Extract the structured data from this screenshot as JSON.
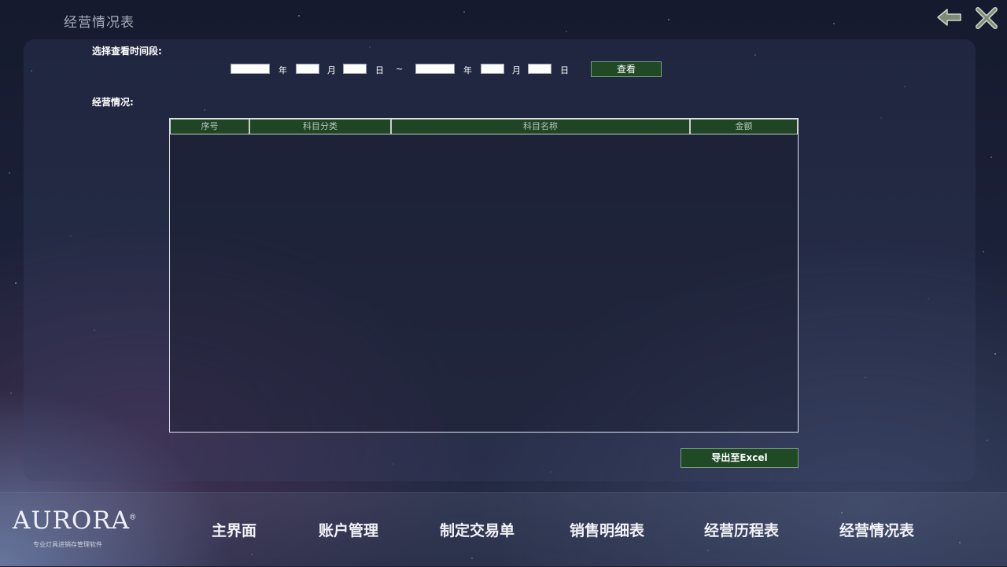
{
  "header": {
    "title": "经营情况表"
  },
  "icons": {
    "back": "back-arrow-icon",
    "close": "close-icon"
  },
  "filter": {
    "label": "选择查看时间段:",
    "unit_year": "年",
    "unit_month": "月",
    "unit_day": "日",
    "separator": "~",
    "start": {
      "year": "",
      "month": "",
      "day": ""
    },
    "end": {
      "year": "",
      "month": "",
      "day": ""
    },
    "view_button": "查看"
  },
  "section": {
    "label": "经营情况:"
  },
  "table": {
    "columns": [
      "序号",
      "科目分类",
      "科目名称",
      "金额"
    ],
    "rows": []
  },
  "export_button": "导出至Excel",
  "logo": {
    "name": "AURORA",
    "mark": "®",
    "tagline": "专业灯具进销存管理软件"
  },
  "nav": {
    "items": [
      "主界面",
      "账户管理",
      "制定交易单",
      "销售明细表",
      "经营历程表",
      "经营情况表"
    ]
  },
  "colors": {
    "accent_green": "#204a26",
    "header_green": "#1f4525"
  }
}
